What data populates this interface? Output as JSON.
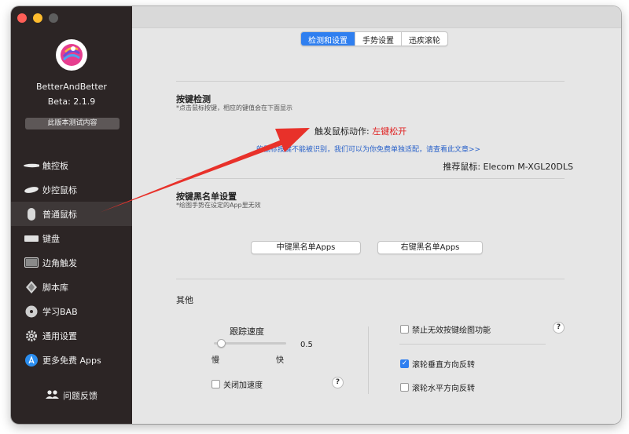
{
  "sidebar": {
    "app_name": "BetterAndBetter",
    "version": "Beta:  2.1.9",
    "beta_button": "此版本测试内容",
    "items": [
      {
        "label": "触控板",
        "icon": "trackpad-icon"
      },
      {
        "label": "妙控鼠标",
        "icon": "magic-mouse-icon"
      },
      {
        "label": "普通鼠标",
        "icon": "mouse-icon"
      },
      {
        "label": "键盘",
        "icon": "keyboard-icon"
      },
      {
        "label": "边角触发",
        "icon": "screen-corner-icon"
      },
      {
        "label": "脚本库",
        "icon": "script-icon"
      },
      {
        "label": "学习BAB",
        "icon": "disc-icon"
      },
      {
        "label": "通用设置",
        "icon": "gear-icon"
      },
      {
        "label": "更多免费 Apps",
        "icon": "app-store-icon"
      }
    ],
    "active_item": "普通鼠标",
    "feedback": "问题反馈"
  },
  "tabs": [
    {
      "label": "检测和设置",
      "selected": true
    },
    {
      "label": "手势设置",
      "selected": false
    },
    {
      "label": "迅疾滚轮",
      "selected": false
    }
  ],
  "detect": {
    "title": "按键检测",
    "subtitle": "*点击鼠标按键，相应的键值会在下面显示",
    "action_label": "触发鼠标动作:",
    "action_value": "左键松开",
    "info_link": "的鼠标按键不能被识别，我们可以为你免费单独适配，请查看此文章>>",
    "recommended": "推荐鼠标:  Elecom M-XGL20DLS"
  },
  "blacklist": {
    "title": "按键黑名单设置",
    "subtitle": "*绘图手势在设定的App里无效",
    "middle_button": "中键黑名单Apps",
    "right_button": "右键黑名单Apps"
  },
  "other": {
    "title": "其他",
    "speed_label": "跟踪速度",
    "speed_value": "0.5",
    "speed_fraction": 0.05,
    "slow": "慢",
    "fast": "快",
    "disable_accel": {
      "label": "关闭加速度",
      "checked": false
    },
    "disable_invalid": {
      "label": "禁止无效按键绘图功能",
      "checked": false
    },
    "reverse_vertical": {
      "label": "滚轮垂直方向反转",
      "checked": true
    },
    "reverse_horizontal": {
      "label": "滚轮水平方向反转",
      "checked": false
    },
    "help": "?"
  },
  "colors": {
    "accent": "#2f7ff0",
    "sidebar_bg": "#2c2525",
    "annotation_arrow": "#e8312a",
    "action_value": "#e02020",
    "link": "#2a62c9"
  }
}
